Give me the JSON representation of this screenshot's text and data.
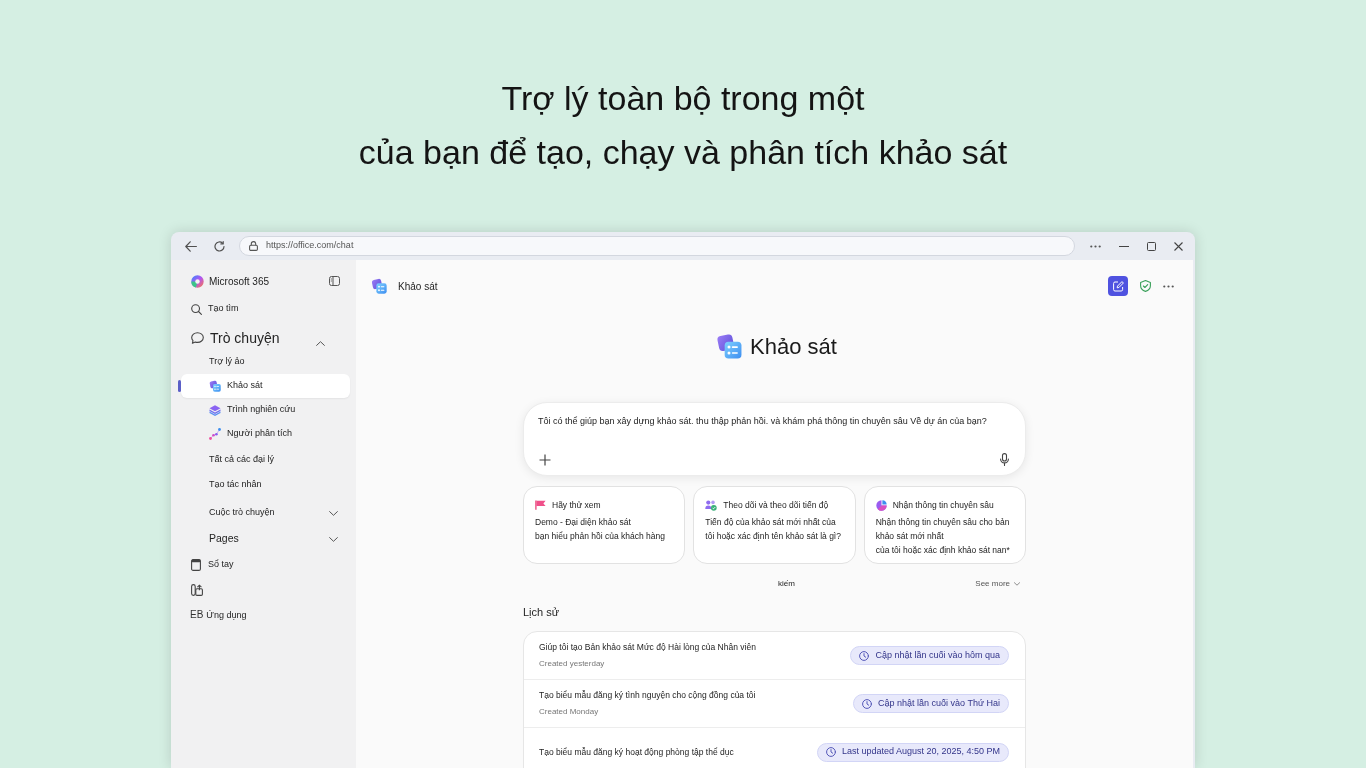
{
  "headline": [
    "Trợ lý toàn bộ trong một",
    "của bạn để tạo, chạy và phân tích khảo sát"
  ],
  "browser": {
    "url": "https://office.com/chat"
  },
  "sidebar": {
    "brand": "Microsoft 365",
    "nav_top": [
      {
        "label": "Tạo tìm"
      }
    ],
    "chat_section": {
      "label": "Trò chuyện",
      "expanded": true,
      "subheading": "Trợ lý ảo",
      "agents": [
        {
          "label": "Khảo sát",
          "selected": true
        },
        {
          "label": "Trình nghiên cứu",
          "selected": false
        },
        {
          "label": "Người phân tích",
          "selected": false
        }
      ],
      "links": [
        {
          "label": "Tất cả các đại lý",
          "selected": false
        },
        {
          "label": "Tạo tác nhân",
          "selected": false
        }
      ],
      "groups": [
        {
          "label": "Cuộc trò chuyện",
          "expanded": false
        },
        {
          "label": "Pages",
          "expanded": false
        }
      ]
    },
    "nav_bottom": [
      {
        "kind": "link",
        "label": "Sổ tay"
      },
      {
        "kind": "icon"
      },
      {
        "kind": "initials",
        "initials": "EB",
        "label": "Ứng dụng"
      }
    ]
  },
  "header": {
    "agent": "Khảo sát"
  },
  "hero": {
    "title": "Khảo sát"
  },
  "prompt": {
    "placeholder": "Tôi có thể giúp bạn xây dựng khảo sát. thu thập phản hồi. và khám phá thông tin chuyên sâu Về dự án của bạn?"
  },
  "suggestions": [
    {
      "title": "Hãy thử xem",
      "lines": [
        "Demo - Đại diện khảo sát",
        "bạn hiểu phản hồi của khách hàng"
      ]
    },
    {
      "title": "Theo dõi và theo dõi tiến độ",
      "lines": [
        "Tiến độ của khảo sát mới nhất của",
        "tôi hoặc xác định tên khảo sát là gì?"
      ]
    },
    {
      "title": "Nhận thông tin chuyên sâu",
      "lines": [
        "Nhận thông tin chuyên sâu cho bản khảo sát mới nhất",
        "của tôi hoặc xác định khảo sát nan*"
      ]
    }
  ],
  "suggestions_footer": {
    "caption": "kiếm",
    "see_more": "See more"
  },
  "history": {
    "title": "Lịch sử",
    "rows": [
      {
        "title": "Giúp tôi tạo Bản khảo sát Mức độ Hài lòng của Nhân viên",
        "created": "Created yesterday",
        "updated": "Cập nhật lần cuối vào hôm qua"
      },
      {
        "title": "Tạo biểu mẫu đăng ký tình nguyện cho cộng đồng của tôi",
        "created": "Created Monday",
        "updated": "Cập nhật lần cuối vào Thứ Hai"
      },
      {
        "title": "Tạo biểu mẫu đăng ký hoạt động phòng tập thể dục",
        "updated": "Last updated August 20, 2025, 4:50 PM"
      }
    ]
  }
}
